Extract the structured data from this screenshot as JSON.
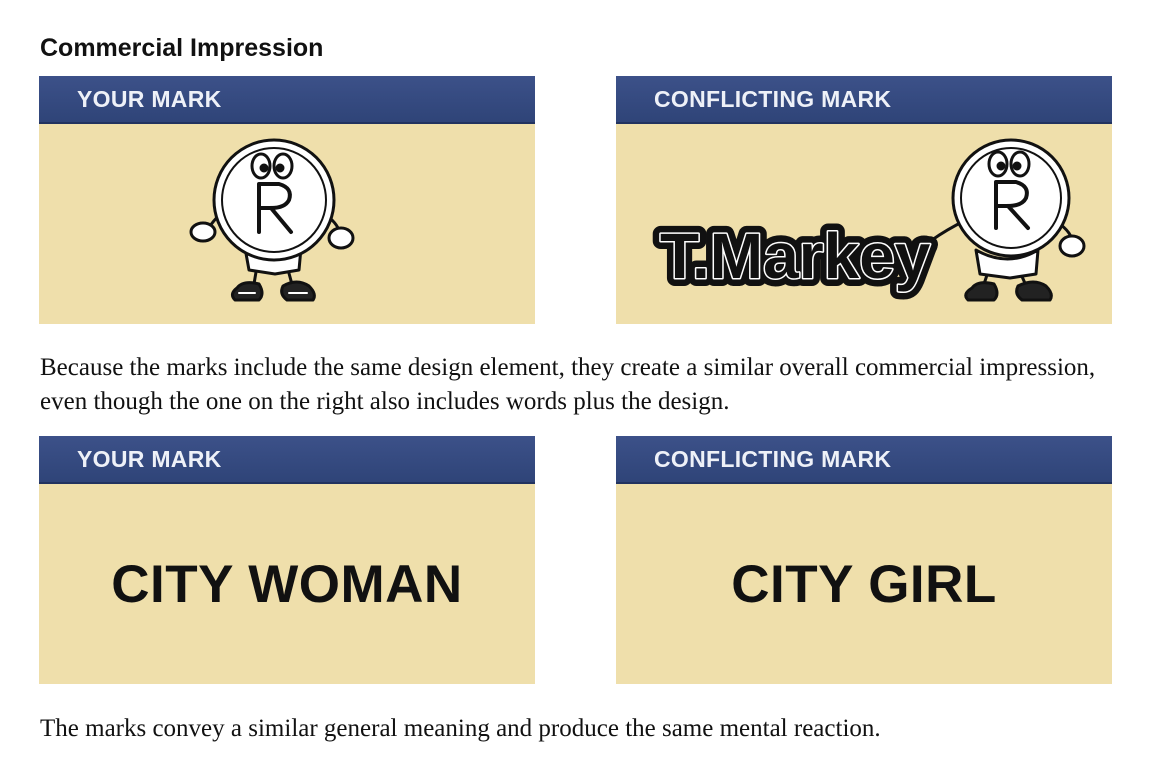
{
  "heading": "Commercial Impression",
  "example1": {
    "left_label": "YOUR MARK",
    "right_label": "CONFLICTING MARK",
    "right_wordmark": "T.Markey",
    "caption": "Because the marks include the same design element, they create a similar overall commercial impression, even though the one on the right also includes words plus the design."
  },
  "example2": {
    "left_label": "YOUR MARK",
    "right_label": "CONFLICTING MARK",
    "left_wordmark": "CITY WOMAN",
    "right_wordmark": "CITY GIRL",
    "caption": "The marks convey a similar general meaning and produce the same mental reaction."
  },
  "colors": {
    "panel_bg": "#efdfab",
    "header_bar": "#34497f",
    "next_heading": "#9b1c31"
  }
}
